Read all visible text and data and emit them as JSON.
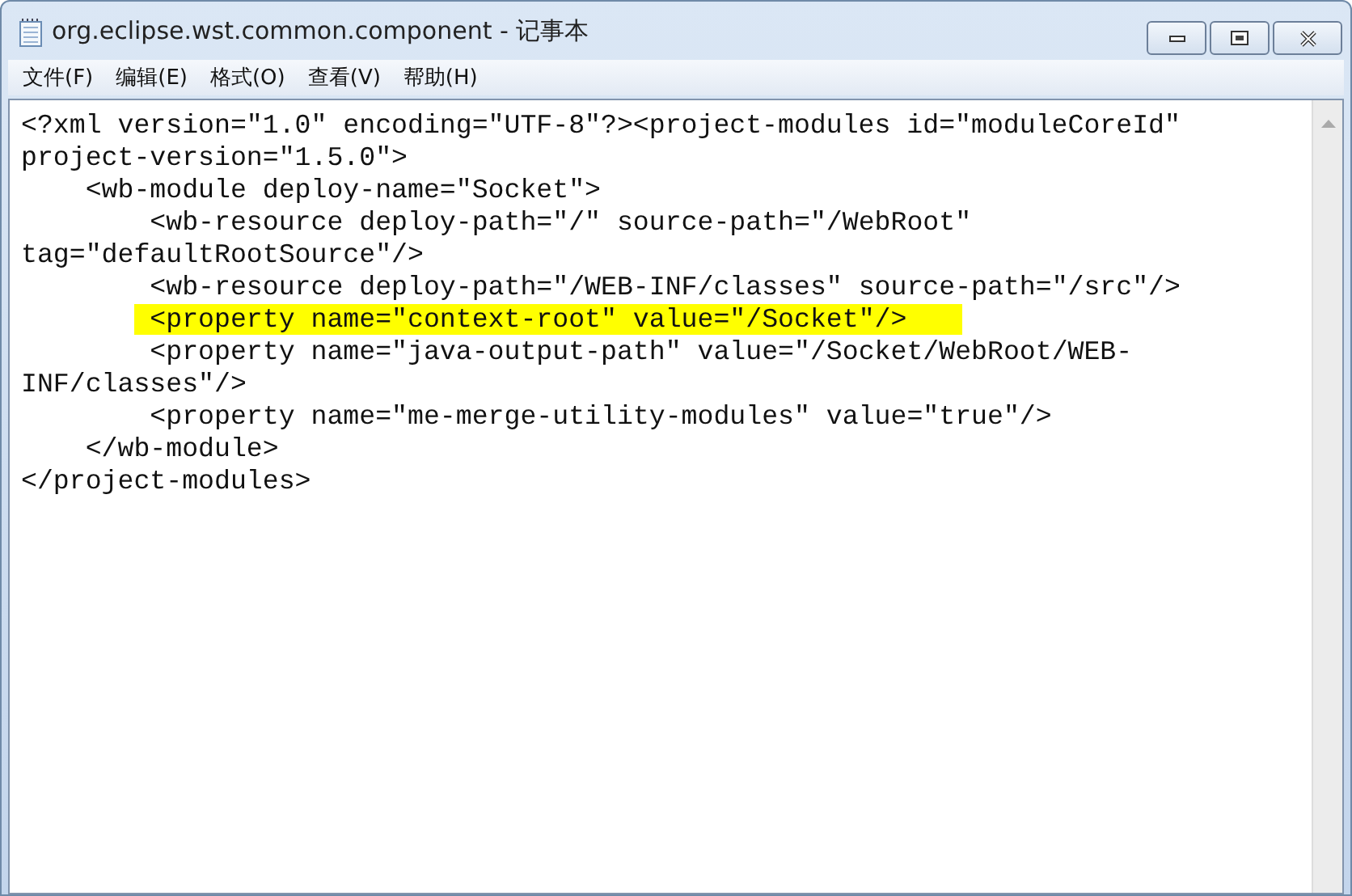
{
  "window": {
    "title": "org.eclipse.wst.common.component - 记事本"
  },
  "menu": [
    {
      "label": "文件(F)"
    },
    {
      "label": "编辑(E)"
    },
    {
      "label": "格式(O)"
    },
    {
      "label": "查看(V)"
    },
    {
      "label": "帮助(H)"
    }
  ],
  "lines": [
    {
      "text": "<?xml version=\"1.0\" encoding=\"UTF-8\"?><project-modules id=\"moduleCoreId\"",
      "highlighted": false
    },
    {
      "text": "project-version=\"1.5.0\">",
      "highlighted": false
    },
    {
      "text": "    <wb-module deploy-name=\"Socket\">",
      "highlighted": false
    },
    {
      "text": "        <wb-resource deploy-path=\"/\" source-path=\"/WebRoot\"",
      "highlighted": false
    },
    {
      "text": "tag=\"defaultRootSource\"/>",
      "highlighted": false
    },
    {
      "text": "        <wb-resource deploy-path=\"/WEB-INF/classes\" source-path=\"/src\"/>",
      "highlighted": false
    },
    {
      "text": "        <property name=\"context-root\" value=\"/Socket\"/>",
      "highlighted": true
    },
    {
      "text": "        <property name=\"java-output-path\" value=\"/Socket/WebRoot/WEB-",
      "highlighted": false
    },
    {
      "text": "INF/classes\"/>",
      "highlighted": false
    },
    {
      "text": "        <property name=\"me-merge-utility-modules\" value=\"true\"/>",
      "highlighted": false
    },
    {
      "text": "    </wb-module>",
      "highlighted": false
    },
    {
      "text": "</project-modules>",
      "highlighted": false
    }
  ]
}
